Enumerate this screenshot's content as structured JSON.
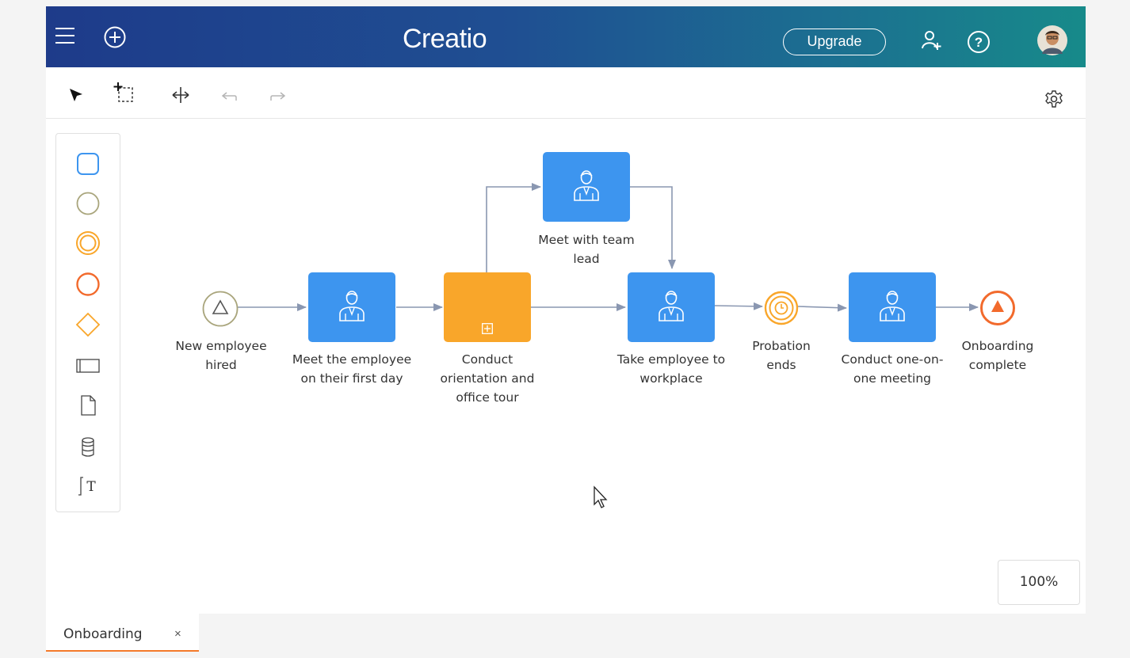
{
  "app": {
    "logo": "Creatio",
    "upgrade_label": "Upgrade",
    "brand_gradient": [
      "#1e3b8a",
      "#178a8a"
    ]
  },
  "toolbar": {
    "tools": [
      "pointer-tool",
      "lasso-select-tool",
      "move-canvas-tool",
      "undo",
      "redo"
    ],
    "settings_icon": "gear-icon"
  },
  "palette": {
    "items": [
      "task-shape",
      "start-event",
      "intermediate-event",
      "end-event",
      "gateway",
      "subprocess-lane",
      "data-object",
      "data-store",
      "text-annotation"
    ]
  },
  "process": {
    "nodes": {
      "start": "New employee\nhired",
      "meet_first_day": "Meet the employee\non their first day",
      "orientation": "Conduct\norientation and\noffice tour",
      "team_lead": "Meet with team\nlead",
      "workplace": "Take employee to\nworkplace",
      "probation": "Probation\nends",
      "one_on_one": "Conduct one-on-\none meeting",
      "complete": "Onboarding\ncomplete"
    },
    "colors": {
      "task": "#3d95ef",
      "subprocess": "#f9a62a",
      "timer": "#f9a62a",
      "end": "#f26a2c",
      "connector": "#8a97b1"
    }
  },
  "zoom": {
    "level": "100%"
  },
  "tabs": [
    {
      "label": "Onboarding",
      "close": "×"
    }
  ]
}
